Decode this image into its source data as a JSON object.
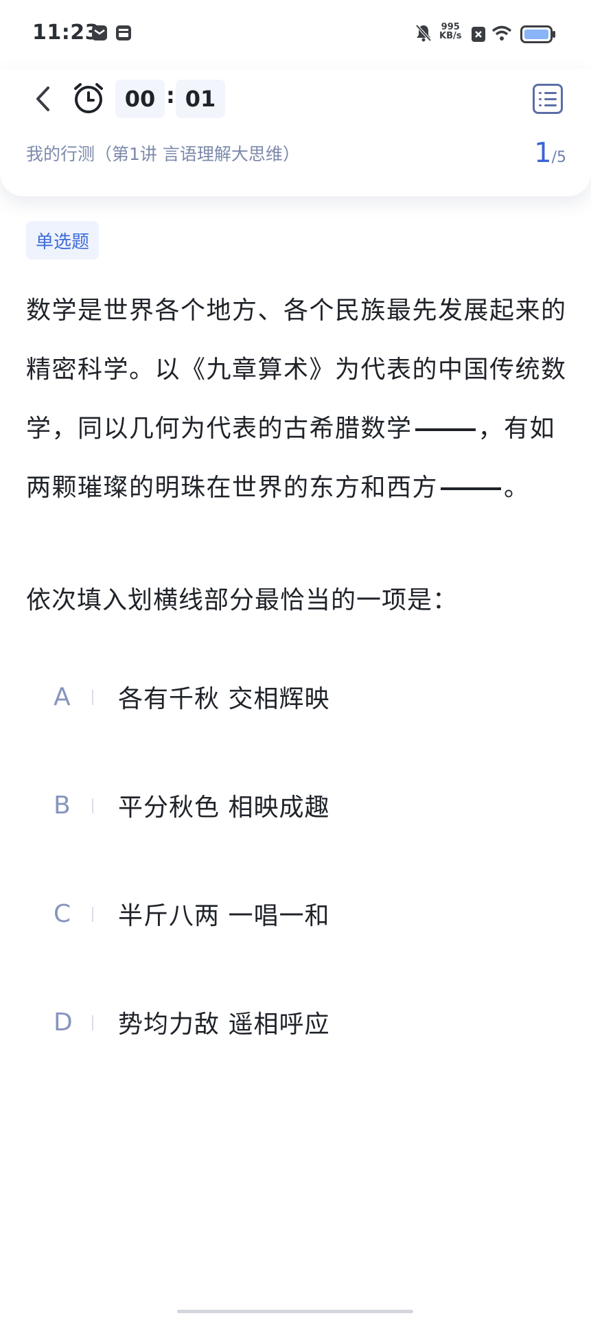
{
  "status_bar": {
    "time": "11:23",
    "net_speed_value": "995",
    "net_speed_unit": "KB/s",
    "icons": [
      "message-icon",
      "calendar-icon",
      "mute-bell-icon",
      "close-box-icon",
      "wifi-icon",
      "battery-icon"
    ]
  },
  "header": {
    "timer_minutes": "00",
    "timer_separator": ":",
    "timer_seconds": "01",
    "breadcrumb": "我的行测（第1讲 言语理解大思维）",
    "current_page": "1",
    "total_pages": "/5"
  },
  "question": {
    "type": "单选题",
    "stem_part1": "数学是世界各个地方、各个民族最先发展起来的精密科学。以《九章算术》为代表的中国传统数学，同以几何为代表的古希腊数学",
    "stem_part2": "，有如两颗璀璨的明珠在世界的东方和西方",
    "stem_part3": "。",
    "instruction": "依次填入划横线部分最恰当的一项是："
  },
  "options": [
    {
      "letter": "A",
      "text": "各有千秋 交相辉映"
    },
    {
      "letter": "B",
      "text": "平分秋色 相映成趣"
    },
    {
      "letter": "C",
      "text": "半斤八两 一唱一和"
    },
    {
      "letter": "D",
      "text": "势均力敌 遥相呼应"
    }
  ],
  "colors": {
    "accent": "#3c64d6",
    "badge_bg": "#eef3fd",
    "option_letter": "#8795bd",
    "breadcrumb": "#7c89ab"
  }
}
